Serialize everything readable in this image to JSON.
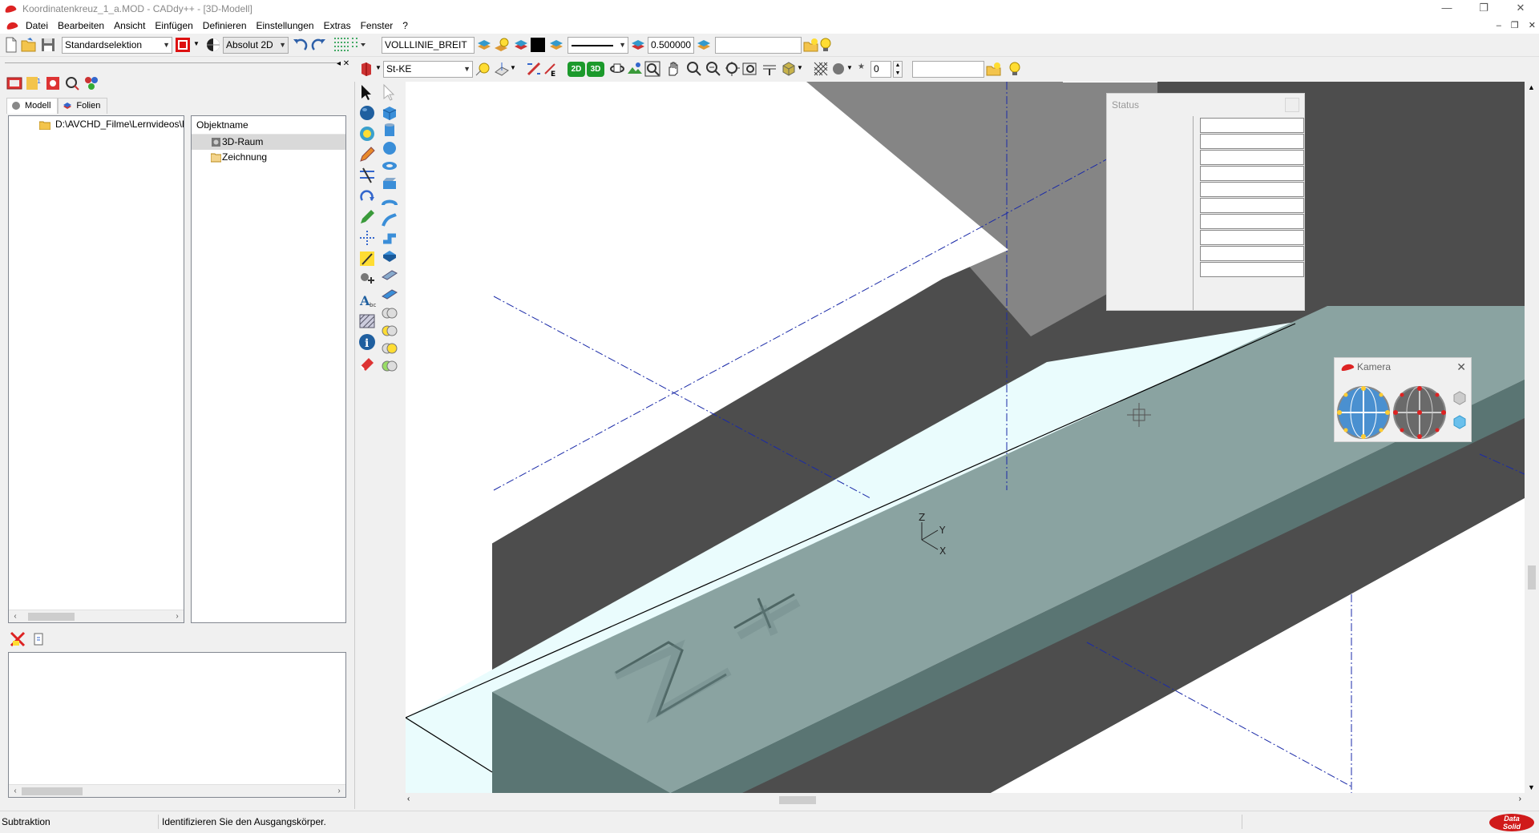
{
  "window": {
    "title": "Koordinatenkreuz_1_a.MOD - CADdy++ - [3D-Modell]",
    "min": "—",
    "restore": "❐",
    "close": "✕"
  },
  "menu": {
    "items": [
      "Datei",
      "Bearbeiten",
      "Ansicht",
      "Einfügen",
      "Definieren",
      "Einstellungen",
      "Extras",
      "Fenster",
      "?"
    ],
    "mdi_min": "–",
    "mdi_restore": "❐",
    "mdi_close": "✕"
  },
  "toolbar1": {
    "selection_mode": "Standardselektion",
    "coordinate_mode": "Absolut 2D",
    "line_type_name": "VOLLLINIE_BREIT",
    "line_width": "0.500000",
    "search_value": ""
  },
  "toolbar2": {
    "material": "St-KE",
    "view_2d": "2D",
    "view_3d": "3D",
    "count_value": "0",
    "extra_value": ""
  },
  "left_panel": {
    "tabs": [
      "Modell",
      "Folien"
    ],
    "tree_path": "D:\\AVCHD_Filme\\Lernvideos\\E",
    "objects_header": "Objektname",
    "objects": [
      {
        "name": "3D-Raum",
        "selected": true
      },
      {
        "name": "Zeichnung",
        "selected": false
      }
    ]
  },
  "dialogs": {
    "status_title": "Status",
    "status_field_count": 10,
    "kamera_title": "Kamera"
  },
  "viewport": {
    "axis_label_z": "Z",
    "axis_label_y": "Y",
    "axis_label_x": "X"
  },
  "statusbar": {
    "mode": "Subtraktion",
    "prompt": "Identifizieren Sie den Ausgangskörper.",
    "brand_line1": "Data",
    "brand_line2": "Solid"
  },
  "colors": {
    "dark_slab": "#4d4d4d",
    "teal_top": "#8aa3a1",
    "teal_side": "#5a7573",
    "gray_face": "#858585",
    "axis_line": "#1a2aa8"
  }
}
